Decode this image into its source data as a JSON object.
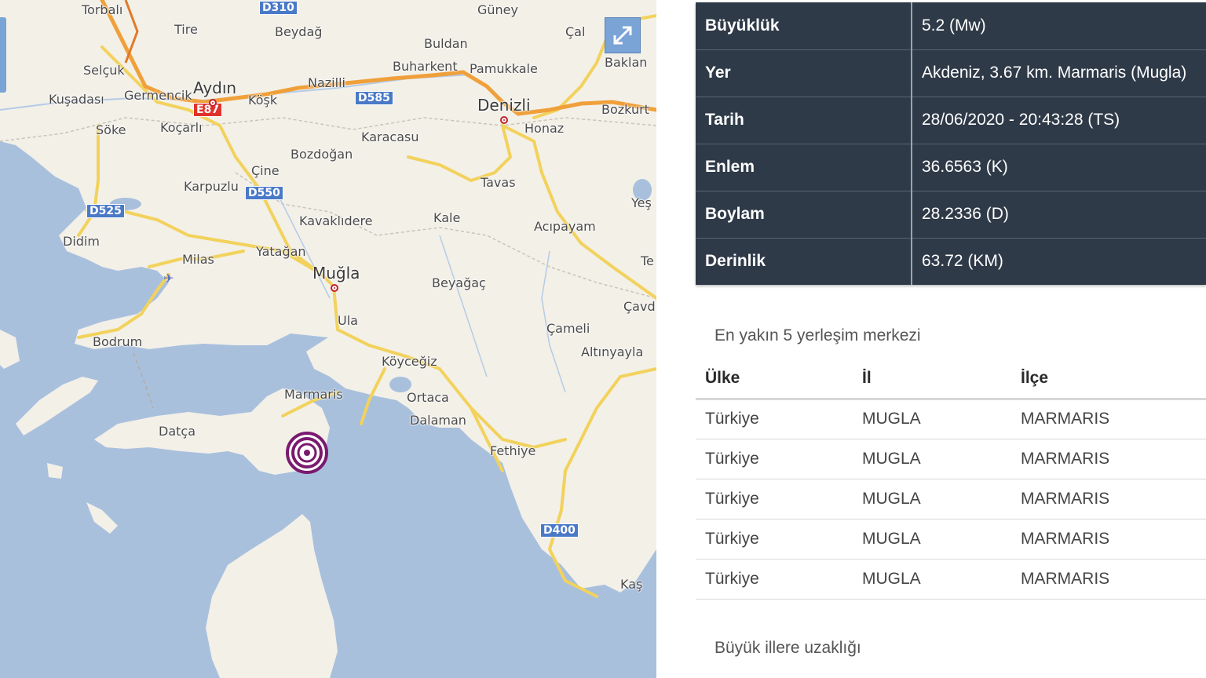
{
  "map": {
    "places": [
      {
        "name": "Torbalı",
        "cls": ""
      },
      {
        "name": "Tire",
        "cls": ""
      },
      {
        "name": "Beydağ",
        "cls": ""
      },
      {
        "name": "Güney",
        "cls": ""
      },
      {
        "name": "Çal",
        "cls": ""
      },
      {
        "name": "Buldan",
        "cls": ""
      },
      {
        "name": "Selçuk",
        "cls": ""
      },
      {
        "name": "Aydın",
        "cls": "big"
      },
      {
        "name": "Germencik",
        "cls": ""
      },
      {
        "name": "Kuşadası",
        "cls": ""
      },
      {
        "name": "Köşk",
        "cls": ""
      },
      {
        "name": "Nazilli",
        "cls": ""
      },
      {
        "name": "Buharkent",
        "cls": ""
      },
      {
        "name": "Pamukkale",
        "cls": ""
      },
      {
        "name": "Baklan",
        "cls": ""
      },
      {
        "name": "Söke",
        "cls": ""
      },
      {
        "name": "Koçarlı",
        "cls": ""
      },
      {
        "name": "Denizli",
        "cls": "big"
      },
      {
        "name": "Honaz",
        "cls": ""
      },
      {
        "name": "Bozkurt",
        "cls": ""
      },
      {
        "name": "Karacasu",
        "cls": ""
      },
      {
        "name": "Bozdoğan",
        "cls": ""
      },
      {
        "name": "Çine",
        "cls": ""
      },
      {
        "name": "Karpuzlu",
        "cls": ""
      },
      {
        "name": "Tavas",
        "cls": ""
      },
      {
        "name": "Yeş",
        "cls": ""
      },
      {
        "name": "Kavaklıdere",
        "cls": ""
      },
      {
        "name": "Kale",
        "cls": ""
      },
      {
        "name": "Acıpayam",
        "cls": ""
      },
      {
        "name": "Didim",
        "cls": ""
      },
      {
        "name": "Milas",
        "cls": ""
      },
      {
        "name": "Yatağan",
        "cls": ""
      },
      {
        "name": "Muğla",
        "cls": "big"
      },
      {
        "name": "Te",
        "cls": ""
      },
      {
        "name": "Beyağaç",
        "cls": ""
      },
      {
        "name": "Çavd",
        "cls": ""
      },
      {
        "name": "Ula",
        "cls": ""
      },
      {
        "name": "Çameli",
        "cls": ""
      },
      {
        "name": "Bodrum",
        "cls": ""
      },
      {
        "name": "Altınyayla",
        "cls": ""
      },
      {
        "name": "Köyceğiz",
        "cls": ""
      },
      {
        "name": "Marmaris",
        "cls": ""
      },
      {
        "name": "Ortaca",
        "cls": ""
      },
      {
        "name": "Datça",
        "cls": ""
      },
      {
        "name": "Dalaman",
        "cls": ""
      },
      {
        "name": "Fethiye",
        "cls": ""
      },
      {
        "name": "Kaş",
        "cls": ""
      }
    ],
    "shields": [
      {
        "label": "D310",
        "red": false
      },
      {
        "label": "D585",
        "red": false
      },
      {
        "label": "E87",
        "red": true
      },
      {
        "label": "D550",
        "red": false
      },
      {
        "label": "D525",
        "red": false
      },
      {
        "label": "D400",
        "red": false
      }
    ],
    "expand_icon": "expand-arrows-icon",
    "epicenter_icon": "epicenter-target-icon"
  },
  "info": {
    "rows": [
      {
        "label": "Büyüklük",
        "value": "5.2 (Mw)"
      },
      {
        "label": "Yer",
        "value": "Akdeniz, 3.67 km. Marmaris (Mugla)"
      },
      {
        "label": "Tarih",
        "value": "28/06/2020 - 20:43:28 (TS)"
      },
      {
        "label": "Enlem",
        "value": "36.6563 (K)"
      },
      {
        "label": "Boylam",
        "value": "28.2336 (D)"
      },
      {
        "label": "Derinlik",
        "value": "63.72 (KM)"
      }
    ]
  },
  "nearby": {
    "title": "En yakın 5 yerleşim merkezi",
    "headers": [
      "Ülke",
      "İl",
      "İlçe"
    ],
    "rows": [
      [
        "Türkiye",
        "MUGLA",
        "MARMARIS"
      ],
      [
        "Türkiye",
        "MUGLA",
        "MARMARIS"
      ],
      [
        "Türkiye",
        "MUGLA",
        "MARMARIS"
      ],
      [
        "Türkiye",
        "MUGLA",
        "MARMARIS"
      ],
      [
        "Türkiye",
        "MUGLA",
        "MARMARIS"
      ]
    ]
  },
  "distances": {
    "title": "Büyük illere uzaklığı"
  },
  "colors": {
    "sea": "#a9c0dd",
    "land": "#f3f0e8",
    "panel_dark": "#2f3a48",
    "epicenter": "#7a1a6e"
  }
}
